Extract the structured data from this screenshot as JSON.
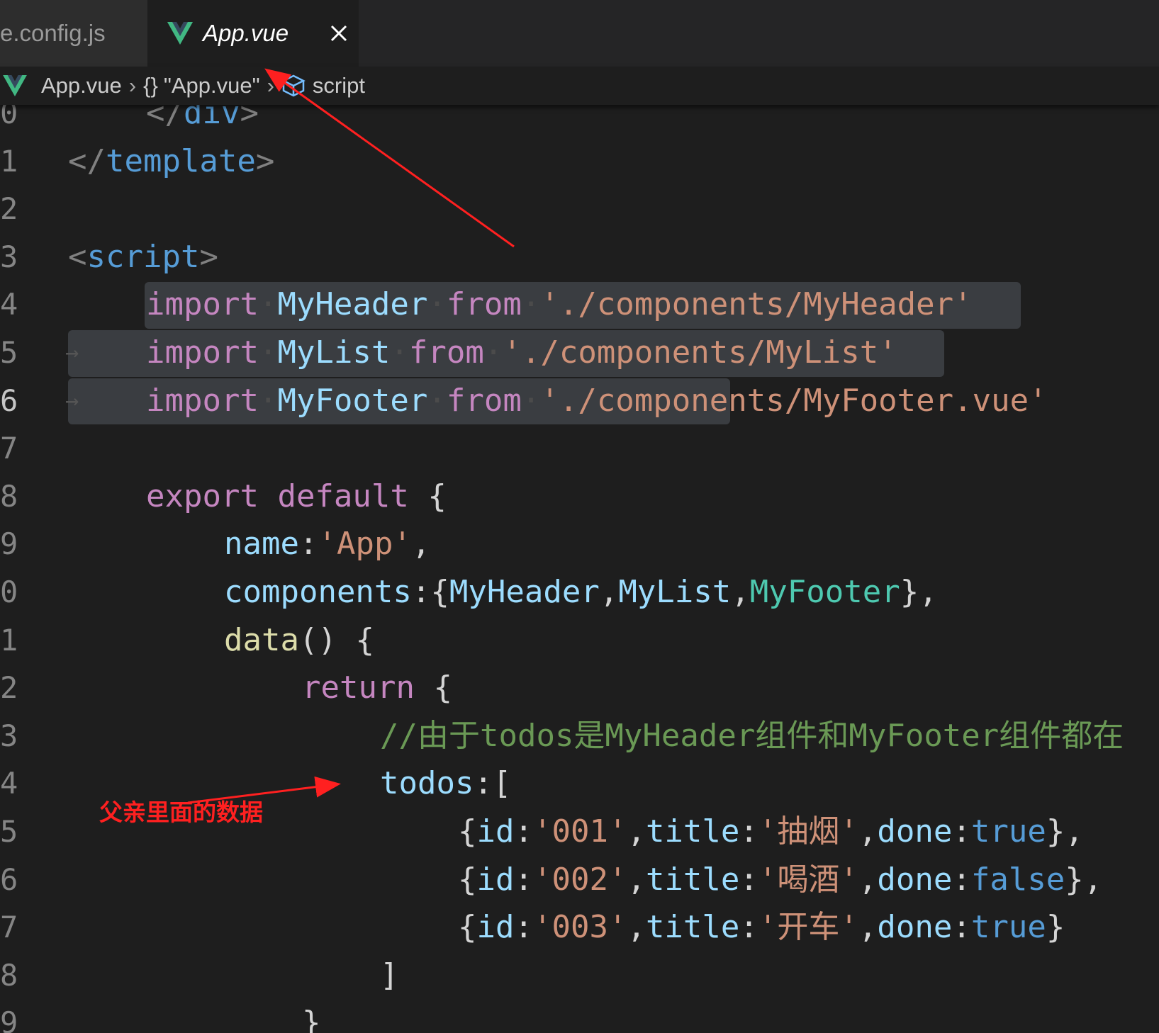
{
  "tabs": {
    "inactive_label": "e.config.js",
    "active_label": "App.vue"
  },
  "breadcrumb": {
    "file": "App.vue",
    "object": "\"App.vue\"",
    "symbol": "script"
  },
  "lines": [
    {
      "num": "0",
      "tokens": [
        {
          "t": "</",
          "c": "tag"
        },
        {
          "t": "div",
          "c": "tagname"
        },
        {
          "t": ">",
          "c": "tag"
        }
      ]
    },
    {
      "num": "1",
      "tokens": [
        {
          "t": "</",
          "c": "tag"
        },
        {
          "t": "template",
          "c": "tagname"
        },
        {
          "t": ">",
          "c": "tag"
        }
      ]
    },
    {
      "num": "2",
      "tokens": []
    },
    {
      "num": "3",
      "tokens": [
        {
          "t": "<",
          "c": "tag"
        },
        {
          "t": "script",
          "c": "tagname"
        },
        {
          "t": ">",
          "c": "tag"
        }
      ]
    },
    {
      "num": "4",
      "tokens": [
        {
          "t": "import",
          "c": "kw"
        },
        {
          "t": "·",
          "c": "ws"
        },
        {
          "t": "MyHeader",
          "c": "id"
        },
        {
          "t": "·",
          "c": "ws"
        },
        {
          "t": "from",
          "c": "kw"
        },
        {
          "t": "·",
          "c": "ws"
        },
        {
          "t": "'./components/MyHeader'",
          "c": "str"
        }
      ]
    },
    {
      "num": "5",
      "tokens": [
        {
          "t": "import",
          "c": "kw"
        },
        {
          "t": "·",
          "c": "ws"
        },
        {
          "t": "MyList",
          "c": "id"
        },
        {
          "t": "·",
          "c": "ws"
        },
        {
          "t": "from",
          "c": "kw"
        },
        {
          "t": "·",
          "c": "ws"
        },
        {
          "t": "'./components/MyList'",
          "c": "str"
        }
      ]
    },
    {
      "num": "6",
      "tokens": [
        {
          "t": "import",
          "c": "kw"
        },
        {
          "t": "·",
          "c": "ws"
        },
        {
          "t": "MyFooter",
          "c": "id"
        },
        {
          "t": "·",
          "c": "ws"
        },
        {
          "t": "from",
          "c": "kw"
        },
        {
          "t": "·",
          "c": "ws"
        },
        {
          "t": "'./components/MyFooter.vue'",
          "c": "str"
        }
      ]
    },
    {
      "num": "7",
      "tokens": []
    },
    {
      "num": "8",
      "tokens": [
        {
          "t": "export",
          "c": "kw"
        },
        {
          "t": " ",
          "c": "punc"
        },
        {
          "t": "default",
          "c": "kw"
        },
        {
          "t": " {",
          "c": "brace"
        }
      ]
    },
    {
      "num": "9",
      "tokens": [
        {
          "t": "name",
          "c": "id"
        },
        {
          "t": ":",
          "c": "punc"
        },
        {
          "t": "'App'",
          "c": "str"
        },
        {
          "t": ",",
          "c": "punc"
        }
      ]
    },
    {
      "num": "0",
      "tokens": [
        {
          "t": "components",
          "c": "id"
        },
        {
          "t": ":{",
          "c": "punc"
        },
        {
          "t": "MyHeader",
          "c": "id"
        },
        {
          "t": ",",
          "c": "punc"
        },
        {
          "t": "MyList",
          "c": "id"
        },
        {
          "t": ",",
          "c": "punc"
        },
        {
          "t": "MyFooter",
          "c": "cls"
        },
        {
          "t": "},",
          "c": "punc"
        }
      ]
    },
    {
      "num": "1",
      "tokens": [
        {
          "t": "data",
          "c": "fn"
        },
        {
          "t": "() {",
          "c": "punc"
        }
      ]
    },
    {
      "num": "2",
      "tokens": [
        {
          "t": "return",
          "c": "kw"
        },
        {
          "t": " {",
          "c": "punc"
        }
      ]
    },
    {
      "num": "3",
      "tokens": [
        {
          "t": "//由于todos是MyHeader组件和MyFooter组件都在",
          "c": "comment"
        }
      ]
    },
    {
      "num": "4",
      "tokens": [
        {
          "t": "todos",
          "c": "id"
        },
        {
          "t": ":[",
          "c": "punc"
        }
      ]
    },
    {
      "num": "5",
      "tokens": [
        {
          "t": "{",
          "c": "punc"
        },
        {
          "t": "id",
          "c": "id"
        },
        {
          "t": ":",
          "c": "punc"
        },
        {
          "t": "'001'",
          "c": "str"
        },
        {
          "t": ",",
          "c": "punc"
        },
        {
          "t": "title",
          "c": "id"
        },
        {
          "t": ":",
          "c": "punc"
        },
        {
          "t": "'抽烟'",
          "c": "str"
        },
        {
          "t": ",",
          "c": "punc"
        },
        {
          "t": "done",
          "c": "id"
        },
        {
          "t": ":",
          "c": "punc"
        },
        {
          "t": "true",
          "c": "kwb"
        },
        {
          "t": "},",
          "c": "punc"
        }
      ]
    },
    {
      "num": "6",
      "tokens": [
        {
          "t": "{",
          "c": "punc"
        },
        {
          "t": "id",
          "c": "id"
        },
        {
          "t": ":",
          "c": "punc"
        },
        {
          "t": "'002'",
          "c": "str"
        },
        {
          "t": ",",
          "c": "punc"
        },
        {
          "t": "title",
          "c": "id"
        },
        {
          "t": ":",
          "c": "punc"
        },
        {
          "t": "'喝酒'",
          "c": "str"
        },
        {
          "t": ",",
          "c": "punc"
        },
        {
          "t": "done",
          "c": "id"
        },
        {
          "t": ":",
          "c": "punc"
        },
        {
          "t": "false",
          "c": "kwb"
        },
        {
          "t": "},",
          "c": "punc"
        }
      ]
    },
    {
      "num": "7",
      "tokens": [
        {
          "t": "{",
          "c": "punc"
        },
        {
          "t": "id",
          "c": "id"
        },
        {
          "t": ":",
          "c": "punc"
        },
        {
          "t": "'003'",
          "c": "str"
        },
        {
          "t": ",",
          "c": "punc"
        },
        {
          "t": "title",
          "c": "id"
        },
        {
          "t": ":",
          "c": "punc"
        },
        {
          "t": "'开车'",
          "c": "str"
        },
        {
          "t": ",",
          "c": "punc"
        },
        {
          "t": "done",
          "c": "id"
        },
        {
          "t": ":",
          "c": "punc"
        },
        {
          "t": "true",
          "c": "kwb"
        },
        {
          "t": "}",
          "c": "punc"
        }
      ]
    },
    {
      "num": "8",
      "tokens": [
        {
          "t": "]",
          "c": "punc"
        }
      ]
    },
    {
      "num": "9",
      "tokens": [
        {
          "t": "}",
          "c": "punc"
        }
      ]
    }
  ],
  "annotation_text": "父亲里面的数据",
  "colors": {
    "editor_bg": "#1e1e1e",
    "vue_green": "#41b883",
    "arrow_red": "#ff2020"
  }
}
